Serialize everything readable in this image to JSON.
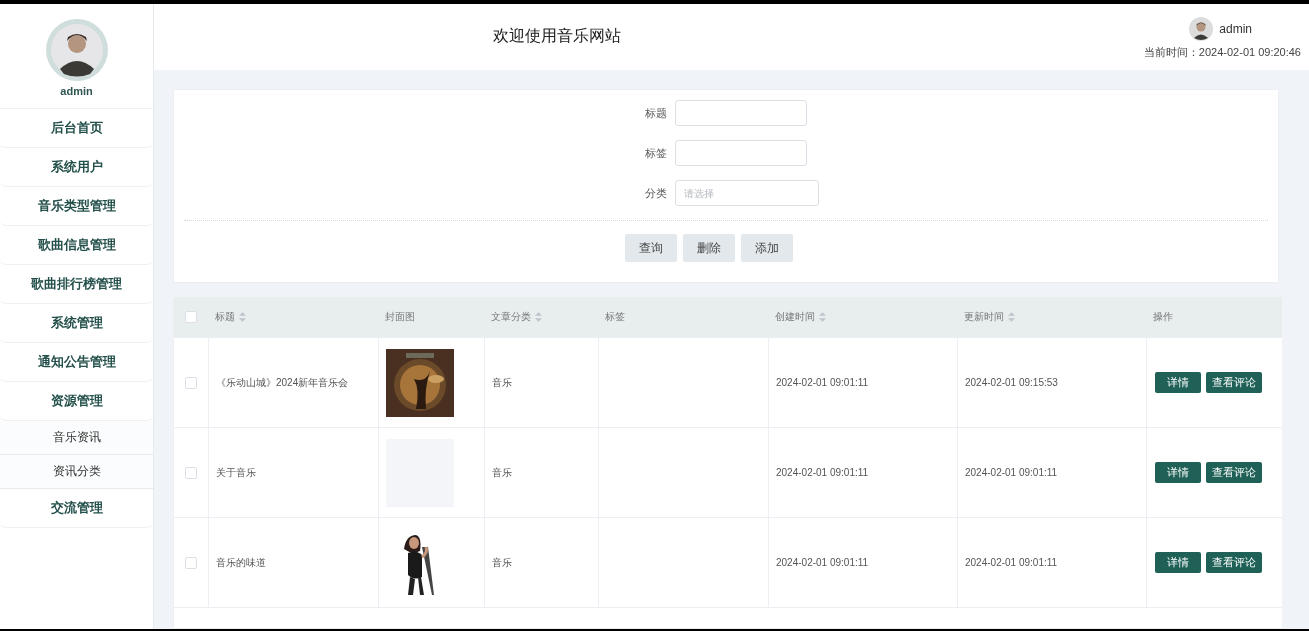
{
  "sidebar": {
    "username": "admin",
    "items": [
      {
        "label": "后台首页",
        "kind": "main"
      },
      {
        "label": "系统用户",
        "kind": "main"
      },
      {
        "label": "音乐类型管理",
        "kind": "main"
      },
      {
        "label": "歌曲信息管理",
        "kind": "main"
      },
      {
        "label": "歌曲排行榜管理",
        "kind": "main"
      },
      {
        "label": "系统管理",
        "kind": "main"
      },
      {
        "label": "通知公告管理",
        "kind": "main"
      },
      {
        "label": "资源管理",
        "kind": "main"
      },
      {
        "label": "音乐资讯",
        "kind": "sub"
      },
      {
        "label": "资讯分类",
        "kind": "sub"
      },
      {
        "label": "交流管理",
        "kind": "main"
      }
    ]
  },
  "header": {
    "title": "欢迎使用音乐网站",
    "username": "admin",
    "time_label": "当前时间：",
    "time": "2024-02-01 09:20:46"
  },
  "search": {
    "fields": [
      {
        "label": "标题",
        "kind": "text"
      },
      {
        "label": "标签",
        "kind": "text"
      },
      {
        "label": "分类",
        "kind": "select",
        "placeholder": "请选择"
      }
    ],
    "buttons": [
      "查询",
      "删除",
      "添加"
    ]
  },
  "table": {
    "header_checked": false,
    "columns": [
      {
        "label": "标题",
        "sortable": true
      },
      {
        "label": "封面图",
        "sortable": false
      },
      {
        "label": "文章分类",
        "sortable": true
      },
      {
        "label": "标签",
        "sortable": false
      },
      {
        "label": "创建时间",
        "sortable": true
      },
      {
        "label": "更新时间",
        "sortable": true
      },
      {
        "label": "操作",
        "sortable": false
      }
    ],
    "rows": [
      {
        "checked": false,
        "title": "《乐动山城》2024新年音乐会",
        "cover": {
          "kind": "picture"
        },
        "category": "音乐",
        "created": "2024-02-01 09:01:11",
        "updated": "2024-02-01 09:15:53",
        "actions": [
          "详情",
          "查看评论"
        ]
      },
      {
        "checked": false,
        "title": "关于音乐",
        "cover": {
          "kind": "blank"
        },
        "category": "音乐",
        "created": "2024-02-01 09:01:11",
        "updated": "2024-02-01 09:01:11",
        "actions": [
          "详情",
          "查看评论"
        ]
      },
      {
        "checked": false,
        "title": "音乐的味道",
        "cover": {
          "kind": "picture"
        },
        "category": "音乐",
        "created": "2024-02-01 09:01:11",
        "updated": "2024-02-01 09:01:11",
        "actions": [
          "详情",
          "查看评论"
        ]
      }
    ]
  }
}
